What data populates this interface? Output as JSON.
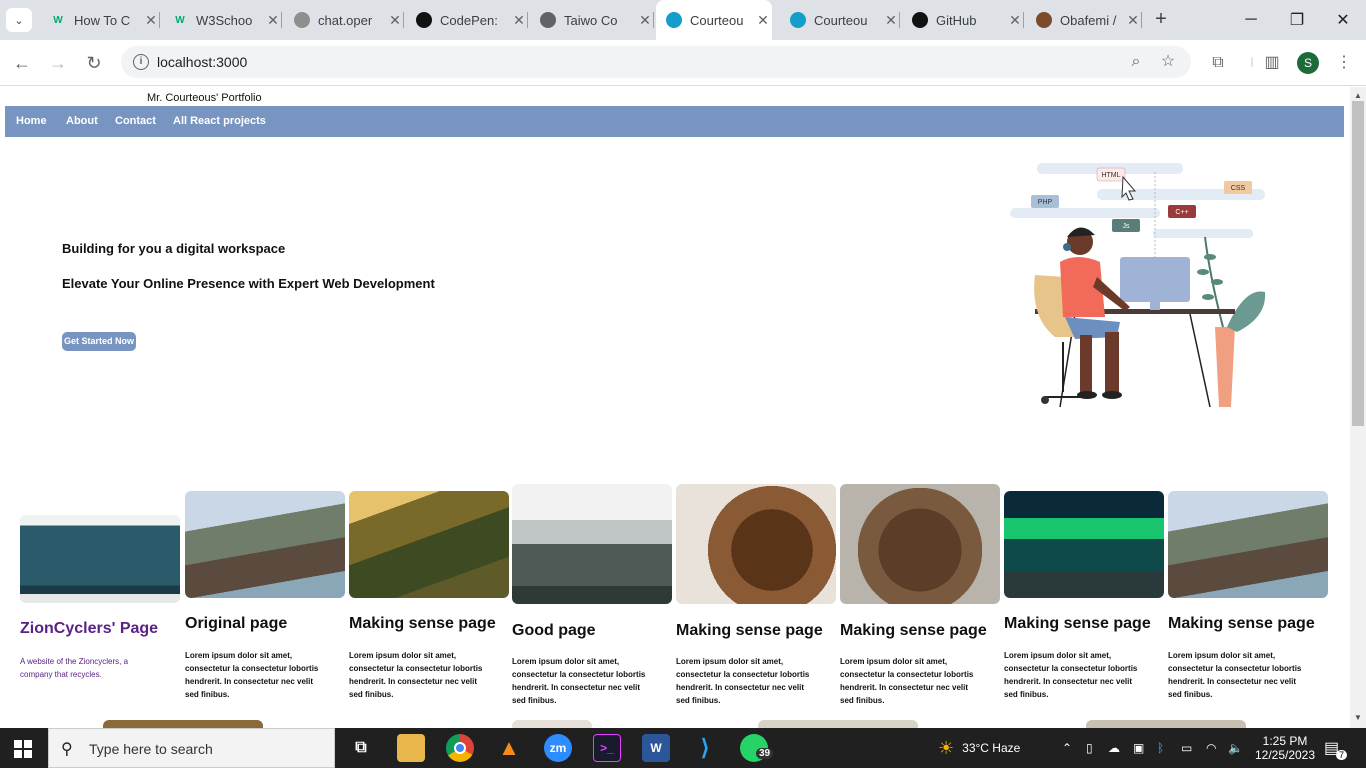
{
  "browser": {
    "tabs": [
      {
        "title": "How To C",
        "favicon": "W",
        "fav_color": "#04aa6d",
        "active": false
      },
      {
        "title": "W3Schoo",
        "favicon": "W",
        "fav_color": "#04aa6d",
        "active": false
      },
      {
        "title": "chat.oper",
        "favicon": "openai-icon",
        "fav_color": "#8e8e8e",
        "active": false
      },
      {
        "title": "CodePen:",
        "favicon": "codepen-icon",
        "fav_color": "#111111",
        "active": false
      },
      {
        "title": "Taiwo Co",
        "favicon": "globe-icon",
        "fav_color": "#5f6368",
        "active": false
      },
      {
        "title": "Courteou",
        "favicon": "react-icon",
        "fav_color": "#149eca",
        "active": true
      },
      {
        "title": "Courteou",
        "favicon": "react-icon",
        "fav_color": "#149eca",
        "active": false
      },
      {
        "title": "GitHub",
        "favicon": "github-icon",
        "fav_color": "#111111",
        "active": false
      },
      {
        "title": "Obafemi /",
        "favicon": "crest-icon",
        "fav_color": "#7a4a2a",
        "active": false
      }
    ],
    "url": "localhost:3000",
    "profile_initial": "S"
  },
  "page": {
    "brand": "Mr. Courteous' Portfolio",
    "nav": [
      "Home",
      "About",
      "Contact",
      "All React projects"
    ],
    "hero": {
      "line1": "Building for you a digital workspace",
      "line2": "Elevate Your Online Presence with Expert Web Development",
      "cta": "Get Started Now"
    },
    "illustration": {
      "tags": [
        "HTML",
        "CSS",
        "PHP",
        "C++",
        "Js"
      ]
    },
    "cards": [
      {
        "title": "ZionCyclers' Page",
        "text": "A website of the Zioncyclers, a company that recycles.",
        "image": "website-screenshot"
      },
      {
        "title": "Original page",
        "text": "Lorem ipsum dolor sit amet, consectetur la consectetur lobortis hendrerit. In consectetur nec velit sed finibus.",
        "image": "mountain-lake"
      },
      {
        "title": "Making sense page",
        "text": "Lorem ipsum dolor sit amet, consectetur la consectetur lobortis hendrerit. In consectetur nec velit sed finibus.",
        "image": "sunlit-valley"
      },
      {
        "title": "Good page",
        "text": "Lorem ipsum dolor sit amet, consectetur la consectetur lobortis hendrerit. In consectetur nec velit sed finibus.",
        "image": "misty-mountain"
      },
      {
        "title": "Making sense page",
        "text": "Lorem ipsum dolor sit amet, consectetur la consectetur lobortis hendrerit. In consectetur nec velit sed finibus.",
        "image": "coffee-beans"
      },
      {
        "title": "Making sense page",
        "text": "Lorem ipsum dolor sit amet, consectetur la consectetur lobortis hendrerit. In consectetur nec velit sed finibus.",
        "image": "brown-bear"
      },
      {
        "title": "Making sense page",
        "text": "Lorem ipsum dolor sit amet, consectetur la consectetur lobortis hendrerit. In consectetur nec velit sed finibus.",
        "image": "aurora"
      },
      {
        "title": "Making sense page",
        "text": "Lorem ipsum dolor sit amet, consectetur la consectetur lobortis hendrerit. In consectetur nec velit sed finibus.",
        "image": "mountain-lake"
      }
    ]
  },
  "taskbar": {
    "search_placeholder": "Type here to search",
    "weather": "33°C  Haze",
    "time": "1:25 PM",
    "date": "12/25/2023",
    "whatsapp_badge": "39",
    "notif_badge": "7",
    "zoom_label": "zm"
  },
  "colors": {
    "nav_bg": "#7895c1",
    "card_title_purple": "#5b2285"
  }
}
